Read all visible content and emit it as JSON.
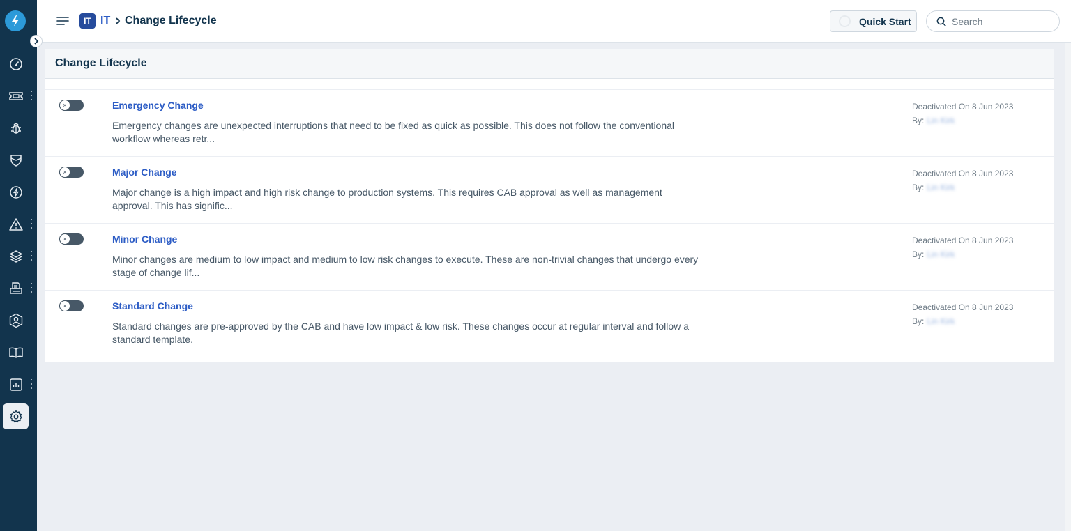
{
  "breadcrumb": {
    "workspace_badge": "IT",
    "workspace": "IT",
    "current": "Change Lifecycle"
  },
  "header": {
    "quick_start_label": "Quick Start",
    "search_placeholder": "Search"
  },
  "panel": {
    "title": "Change Lifecycle"
  },
  "changes": [
    {
      "name": "Emergency Change",
      "description": "Emergency changes are unexpected interruptions that need to be fixed as quick as possible. This does not follow the conventional workflow whereas retr...",
      "status": "Deactivated On 8 Jun 2023",
      "by_label": "By:",
      "by_value": "Lin Kirk"
    },
    {
      "name": "Major Change",
      "description": "Major change is a high impact and high risk change to production systems. This requires CAB approval as well as management approval. This has signific...",
      "status": "Deactivated On 8 Jun 2023",
      "by_label": "By:",
      "by_value": "Lin Kirk"
    },
    {
      "name": "Minor Change",
      "description": "Minor changes are medium to low impact and medium to low risk changes to execute. These are non-trivial changes that undergo every stage of change lif...",
      "status": "Deactivated On 8 Jun 2023",
      "by_label": "By:",
      "by_value": "Lin Kirk"
    },
    {
      "name": "Standard Change",
      "description": "Standard changes are pre-approved by the CAB and have low impact & low risk. These changes occur at regular interval and follow a standard template.",
      "status": "Deactivated On 8 Jun 2023",
      "by_label": "By:",
      "by_value": "Lin Kirk"
    }
  ],
  "toggles": {
    "off_symbol": "×"
  },
  "colors": {
    "sidebar": "#12344d",
    "accent": "#2c5cc5",
    "logo": "#2c9ad9",
    "badge": "#264b9c"
  },
  "sidebar_icons": [
    "dashboard-icon",
    "ticket-icon",
    "bug-icon",
    "shield-icon",
    "lightning-icon",
    "warning-icon",
    "layers-icon",
    "printer-icon",
    "user-badge-icon",
    "book-icon",
    "report-icon",
    "gear-icon"
  ]
}
